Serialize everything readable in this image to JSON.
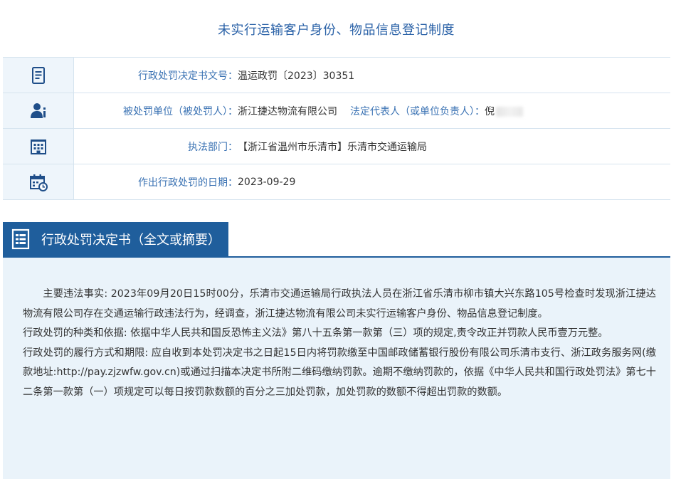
{
  "page": {
    "title": "未实行运输客户身份、物品信息登记制度"
  },
  "info": {
    "doc_number": {
      "icon": "document-icon",
      "label": "行政处罚决定书文号：",
      "value": "温运政罚〔2023〕30351"
    },
    "party": {
      "icon": "user-icon",
      "label": "被处罚单位（被处罚人）：",
      "value": "浙江捷达物流有限公司",
      "rep_label": "法定代表人（或单位负责人）：",
      "rep_value": "倪"
    },
    "department": {
      "icon": "building-icon",
      "label": "执法部门：",
      "value": "【浙江省温州市乐清市】乐清市交通运输局"
    },
    "date": {
      "icon": "calendar-clock-icon",
      "label": "作出行政处罚的日期：",
      "value": "2023-09-29"
    }
  },
  "section": {
    "icon": "document-list-icon",
    "title": "行政处罚决定书（全文或摘要）"
  },
  "content": {
    "paragraphs": [
      "主要违法事实: 2023年09月20日15时00分，乐清市交通运输局行政执法人员在浙江省乐清市柳市镇大兴东路105号检查时发现浙江捷达物流有限公司存在交通运输行政违法行为，经调查，浙江捷达物流有限公司未实行运输客户身份、物品信息登记制度。",
      "行政处罚的种类和依据: 依据中华人民共和国反恐怖主义法》第八十五条第一款第（三）项的规定,责令改正并罚款人民币壹万元整。",
      "行政处罚的履行方式和期限: 应自收到本处罚决定书之日起15日内将罚款缴至中国邮政储蓄银行股份有限公司乐清市支行、浙江政务服务网(缴款地址:http://pay.zjzwfw.gov.cn)或通过扫描本决定书所附二维码缴纳罚款。逾期不缴纳罚款的，依据《中华人民共和国行政处罚法》第七十二条第一款第（一）项规定可以每日按罚款数额的百分之三加处罚款，加处罚款的数额不得超出罚款的数额。"
    ]
  },
  "colors": {
    "accent": "#1f5e9c",
    "title": "#2c63a8",
    "label": "#3a72b3",
    "panel_bg": "#eaf3fa",
    "border": "#d6e4ef"
  }
}
